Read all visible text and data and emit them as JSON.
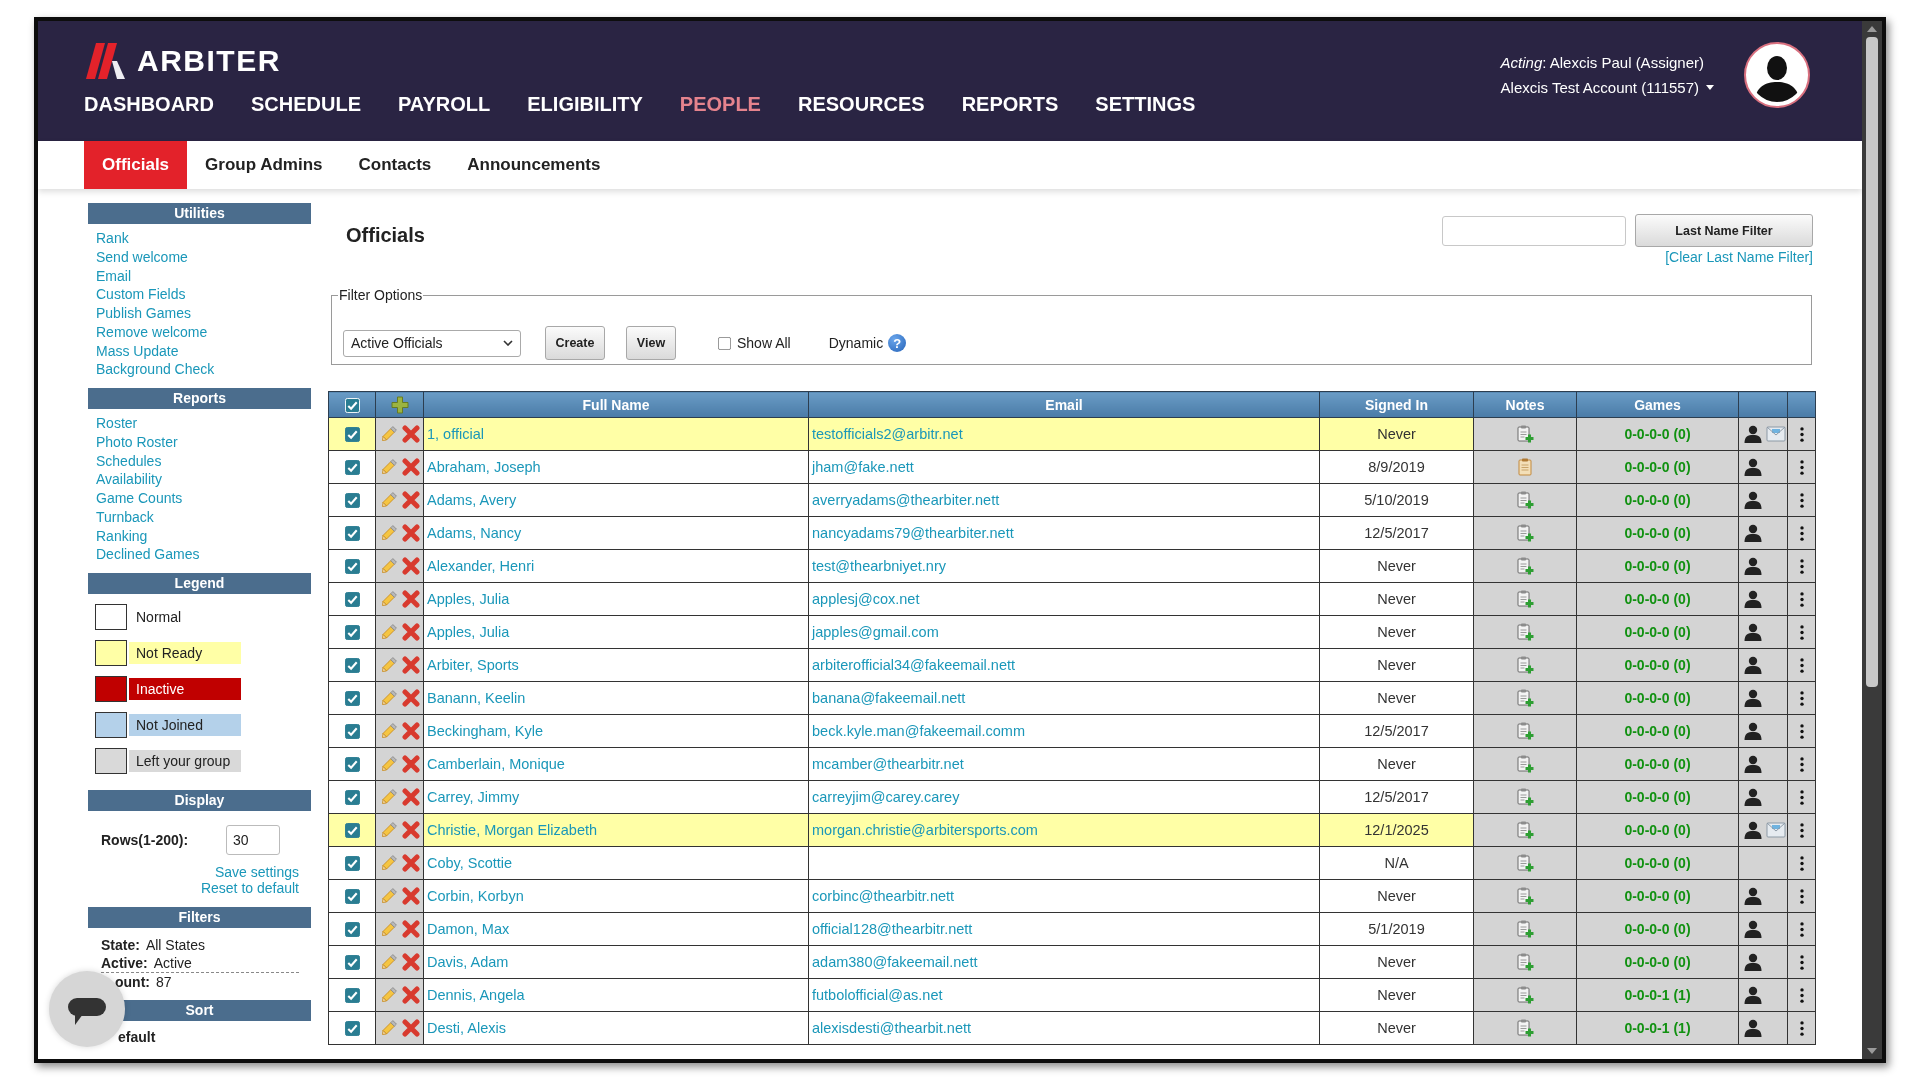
{
  "header": {
    "logo": "ARBITER",
    "nav": [
      {
        "label": "DASHBOARD",
        "selected": false
      },
      {
        "label": "SCHEDULE",
        "selected": false
      },
      {
        "label": "PAYROLL",
        "selected": false
      },
      {
        "label": "ELIGIBILITY",
        "selected": false
      },
      {
        "label": "PEOPLE",
        "selected": true
      },
      {
        "label": "RESOURCES",
        "selected": false
      },
      {
        "label": "REPORTS",
        "selected": false
      },
      {
        "label": "SETTINGS",
        "selected": false
      }
    ],
    "acting": "*Acting*: Alexcis Paul (Assigner)",
    "account": "Alexcis Test Account (111557)"
  },
  "subnav": [
    {
      "label": "Officials",
      "selected": true
    },
    {
      "label": "Group Admins",
      "selected": false
    },
    {
      "label": "Contacts",
      "selected": false
    },
    {
      "label": "Announcements",
      "selected": false
    }
  ],
  "sidebar": {
    "sections": [
      {
        "kind": "links",
        "title": "Utilities",
        "links": [
          "Rank",
          "Send welcome",
          "Email",
          "Custom Fields",
          "Publish Games",
          "Remove welcome",
          "Mass Update",
          "Background Check"
        ]
      },
      {
        "kind": "links",
        "title": "Reports",
        "links": [
          "Roster",
          "Photo Roster",
          "Schedules",
          "Availability",
          "Game Counts",
          "Turnback",
          "Ranking",
          "Declined Games"
        ]
      },
      {
        "kind": "legend",
        "title": "Legend",
        "items": [
          {
            "label": "Normal",
            "color": "#ffffff"
          },
          {
            "label": "Not Ready",
            "color": "#ffffa6"
          },
          {
            "label": "Inactive",
            "color": "#c00000"
          },
          {
            "label": "Not Joined",
            "color": "#b4d1ea"
          },
          {
            "label": "Left your group",
            "color": "#d9d9d9"
          }
        ]
      },
      {
        "kind": "display",
        "title": "Display",
        "rows_label": "Rows(1-200):",
        "rows_value": "30",
        "links": [
          "Save settings",
          "Reset to default"
        ]
      },
      {
        "kind": "filters",
        "title": "Filters",
        "fields": [
          {
            "label": "State:",
            "value": "All States"
          },
          {
            "label": "Active:",
            "value": "Active"
          },
          {
            "label": "ount:",
            "value": "87"
          }
        ]
      },
      {
        "kind": "sort",
        "title": "Sort",
        "value": "efault"
      }
    ]
  },
  "main": {
    "title": "Officials",
    "last_name_filter": {
      "button": "Last Name Filter",
      "clear_link": "[Clear Last Name Filter]"
    },
    "filter_options": {
      "legend": "Filter Options",
      "select": "Active Officials",
      "buttons": [
        "Create",
        "View"
      ],
      "show_all": {
        "label": "Show All",
        "checked": false
      },
      "dynamic": {
        "label": "Dynamic",
        "help": "?"
      }
    },
    "table": {
      "select_all_checked": true,
      "columns": [
        "Full Name",
        "Email",
        "Signed In",
        "Notes",
        "Games"
      ],
      "rows": [
        {
          "checked": true,
          "not_ready": true,
          "name": "1, official",
          "email": "testofficials2@arbitr.net",
          "signed_in": "Never",
          "has_notes": false,
          "games": "0-0-0-0 (0)",
          "profile": true,
          "message": true
        },
        {
          "checked": true,
          "not_ready": false,
          "name": "Abraham, Joseph",
          "email": "jham@fake.nett",
          "signed_in": "8/9/2019",
          "has_notes": true,
          "games": "0-0-0-0 (0)",
          "profile": true,
          "message": false
        },
        {
          "checked": true,
          "not_ready": false,
          "name": "Adams, Avery",
          "email": "averryadams@thearbiter.nett",
          "signed_in": "5/10/2019",
          "has_notes": false,
          "games": "0-0-0-0 (0)",
          "profile": true,
          "message": false
        },
        {
          "checked": true,
          "not_ready": false,
          "name": "Adams, Nancy",
          "email": "nancyadams79@thearbiter.nett",
          "signed_in": "12/5/2017",
          "has_notes": false,
          "games": "0-0-0-0 (0)",
          "profile": true,
          "message": false
        },
        {
          "checked": true,
          "not_ready": false,
          "name": "Alexander, Henri",
          "email": "test@thearbniyet.nry",
          "signed_in": "Never",
          "has_notes": false,
          "games": "0-0-0-0 (0)",
          "profile": true,
          "message": false
        },
        {
          "checked": true,
          "not_ready": false,
          "name": "Apples, Julia",
          "email": "applesj@cox.net",
          "signed_in": "Never",
          "has_notes": false,
          "games": "0-0-0-0 (0)",
          "profile": true,
          "message": false
        },
        {
          "checked": true,
          "not_ready": false,
          "name": "Apples, Julia",
          "email": "japples@gmail.com",
          "signed_in": "Never",
          "has_notes": false,
          "games": "0-0-0-0 (0)",
          "profile": true,
          "message": false
        },
        {
          "checked": true,
          "not_ready": false,
          "name": "Arbiter, Sports",
          "email": "arbiterofficial34@fakeemail.nett",
          "signed_in": "Never",
          "has_notes": false,
          "games": "0-0-0-0 (0)",
          "profile": true,
          "message": false
        },
        {
          "checked": true,
          "not_ready": false,
          "name": "Banann, Keelin",
          "email": "banana@fakeemail.nett",
          "signed_in": "Never",
          "has_notes": false,
          "games": "0-0-0-0 (0)",
          "profile": true,
          "message": false
        },
        {
          "checked": true,
          "not_ready": false,
          "name": "Beckingham, Kyle",
          "email": "beck.kyle.man@fakeemail.comm",
          "signed_in": "12/5/2017",
          "has_notes": false,
          "games": "0-0-0-0 (0)",
          "profile": true,
          "message": false
        },
        {
          "checked": true,
          "not_ready": false,
          "name": "Camberlain, Monique",
          "email": "mcamber@thearbitr.net",
          "signed_in": "Never",
          "has_notes": false,
          "games": "0-0-0-0 (0)",
          "profile": true,
          "message": false
        },
        {
          "checked": true,
          "not_ready": false,
          "name": "Carrey, Jimmy",
          "email": "carreyjim@carey.carey",
          "signed_in": "12/5/2017",
          "has_notes": false,
          "games": "0-0-0-0 (0)",
          "profile": true,
          "message": false
        },
        {
          "checked": true,
          "not_ready": true,
          "name": "Christie, Morgan Elizabeth",
          "email": "morgan.christie@arbitersports.com",
          "signed_in": "12/1/2025",
          "has_notes": false,
          "games": "0-0-0-0 (0)",
          "profile": true,
          "message": true
        },
        {
          "checked": true,
          "not_ready": false,
          "name": "Coby, Scottie",
          "signed_in": "N/A",
          "has_notes": false,
          "games": "0-0-0-0 (0)",
          "profile": false,
          "message": false
        },
        {
          "checked": true,
          "not_ready": false,
          "name": "Corbin, Korbyn",
          "email": "corbinc@thearbitr.nett",
          "signed_in": "Never",
          "has_notes": false,
          "games": "0-0-0-0 (0)",
          "profile": true,
          "message": false
        },
        {
          "checked": true,
          "not_ready": false,
          "name": "Damon, Max",
          "email": "official128@thearbitr.nett",
          "signed_in": "5/1/2019",
          "has_notes": false,
          "games": "0-0-0-0 (0)",
          "profile": true,
          "message": false
        },
        {
          "checked": true,
          "not_ready": false,
          "name": "Davis, Adam",
          "email": "adam380@fakeemail.nett",
          "signed_in": "Never",
          "has_notes": false,
          "games": "0-0-0-0 (0)",
          "profile": true,
          "message": false
        },
        {
          "checked": true,
          "not_ready": false,
          "name": "Dennis, Angela",
          "email": "futbolofficial@as.net",
          "signed_in": "Never",
          "has_notes": false,
          "games": "0-0-0-1 (1)",
          "profile": true,
          "message": false
        },
        {
          "checked": true,
          "not_ready": false,
          "name": "Desti, Alexis",
          "email": "alexisdesti@thearbit.nett",
          "signed_in": "Never",
          "has_notes": false,
          "games": "0-0-0-1 (1)",
          "profile": true,
          "message": false
        }
      ]
    }
  }
}
